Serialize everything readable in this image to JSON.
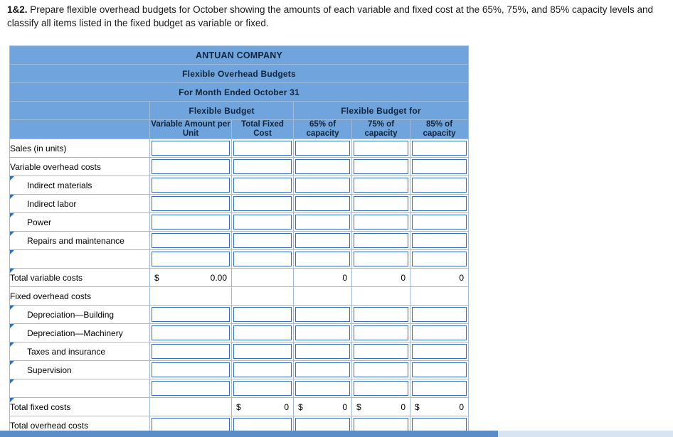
{
  "question": {
    "number": "1&2.",
    "text": " Prepare flexible overhead budgets for October showing the amounts of each variable and fixed cost at the 65%, 75%, and 85% capacity levels and classify all items listed in the fixed budget as variable or fixed."
  },
  "sheet": {
    "title_line1": "ANTUAN COMPANY",
    "title_line2": "Flexible Overhead Budgets",
    "title_line3": "For Month Ended October 31",
    "group_headers": {
      "flexible_budget": "Flexible Budget",
      "flexible_budget_for": "Flexible Budget for"
    },
    "column_headers": {
      "blank": "",
      "variable_amount": "Variable Amount per Unit",
      "total_fixed_cost": "Total Fixed Cost",
      "cap_65": "65% of capacity",
      "cap_75": "75% of capacity",
      "cap_85": "85% of capacity"
    },
    "rows": [
      {
        "label": "Sales (in units)",
        "indent": false,
        "marker": false,
        "type": "input",
        "values": [
          "",
          "",
          "",
          "",
          ""
        ]
      },
      {
        "label": "Variable overhead costs",
        "indent": false,
        "marker": false,
        "type": "input",
        "values": [
          "",
          "",
          "",
          "",
          ""
        ]
      },
      {
        "label": "Indirect materials",
        "indent": true,
        "marker": true,
        "type": "input",
        "values": [
          "",
          "",
          "",
          "",
          ""
        ]
      },
      {
        "label": "Indirect labor",
        "indent": true,
        "marker": true,
        "type": "input",
        "values": [
          "",
          "",
          "",
          "",
          ""
        ]
      },
      {
        "label": "Power",
        "indent": true,
        "marker": true,
        "type": "input",
        "values": [
          "",
          "",
          "",
          "",
          ""
        ]
      },
      {
        "label": "Repairs and maintenance",
        "indent": true,
        "marker": true,
        "type": "input",
        "values": [
          "",
          "",
          "",
          "",
          ""
        ]
      },
      {
        "label": "",
        "indent": false,
        "marker": true,
        "type": "input",
        "values": [
          "",
          "",
          "",
          "",
          ""
        ]
      },
      {
        "label": "Total variable costs",
        "indent": false,
        "marker": true,
        "type": "total",
        "values": [
          "0.00",
          "",
          "0",
          "0",
          "0"
        ],
        "dollars": [
          true,
          false,
          false,
          false,
          false
        ]
      },
      {
        "label": "Fixed overhead costs",
        "indent": false,
        "marker": false,
        "type": "plain",
        "values": [
          "",
          "",
          "",
          "",
          ""
        ]
      },
      {
        "label": "Depreciation—Building",
        "indent": true,
        "marker": true,
        "type": "input",
        "values": [
          "",
          "",
          "",
          "",
          ""
        ]
      },
      {
        "label": "Depreciation—Machinery",
        "indent": true,
        "marker": true,
        "type": "input",
        "values": [
          "",
          "",
          "",
          "",
          ""
        ]
      },
      {
        "label": "Taxes and insurance",
        "indent": true,
        "marker": true,
        "type": "input",
        "values": [
          "",
          "",
          "",
          "",
          ""
        ]
      },
      {
        "label": "Supervision",
        "indent": true,
        "marker": true,
        "type": "input",
        "values": [
          "",
          "",
          "",
          "",
          ""
        ]
      },
      {
        "label": "",
        "indent": false,
        "marker": true,
        "type": "input",
        "values": [
          "",
          "",
          "",
          "",
          ""
        ]
      },
      {
        "label": "Total fixed costs",
        "indent": false,
        "marker": true,
        "type": "total",
        "values": [
          "",
          "0",
          "0",
          "0",
          "0"
        ],
        "dollars": [
          false,
          true,
          true,
          true,
          true
        ]
      },
      {
        "label": "Total overhead costs",
        "indent": false,
        "marker": false,
        "type": "lastrow",
        "values": [
          "",
          "",
          "",
          "",
          ""
        ]
      }
    ]
  },
  "scrollbar": {
    "name": "horizontal-scrollbar"
  }
}
